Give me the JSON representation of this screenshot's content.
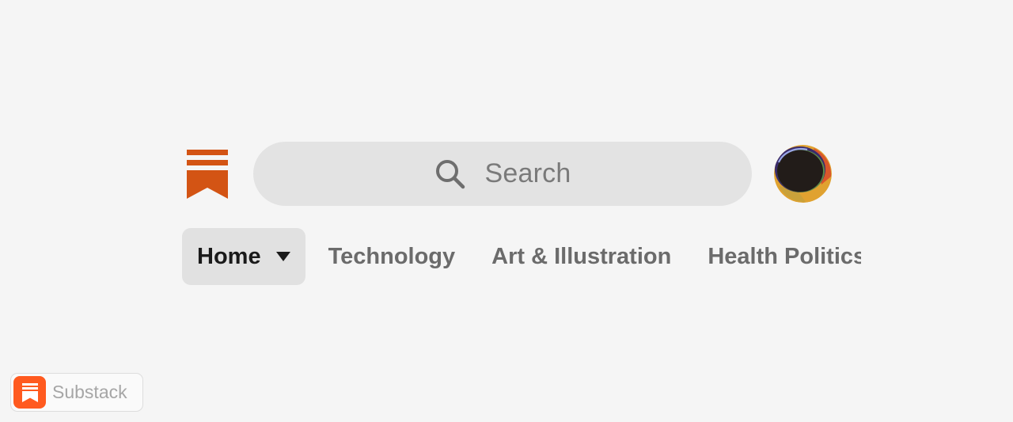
{
  "header": {
    "logo_icon": "substack-bookmark-icon",
    "brand_color": "#d35414",
    "search": {
      "icon": "search-icon",
      "placeholder": "Search"
    },
    "avatar_icon": "user-avatar"
  },
  "tabs": [
    {
      "label": "Home",
      "active": true,
      "icon": "caret-down-icon"
    },
    {
      "label": "Technology",
      "active": false
    },
    {
      "label": "Art & Illustration",
      "active": false
    },
    {
      "label": "Health Politics",
      "active": false
    }
  ],
  "badge": {
    "icon": "substack-logo-icon",
    "label": "Substack",
    "accent_color": "#ff5a1f"
  }
}
